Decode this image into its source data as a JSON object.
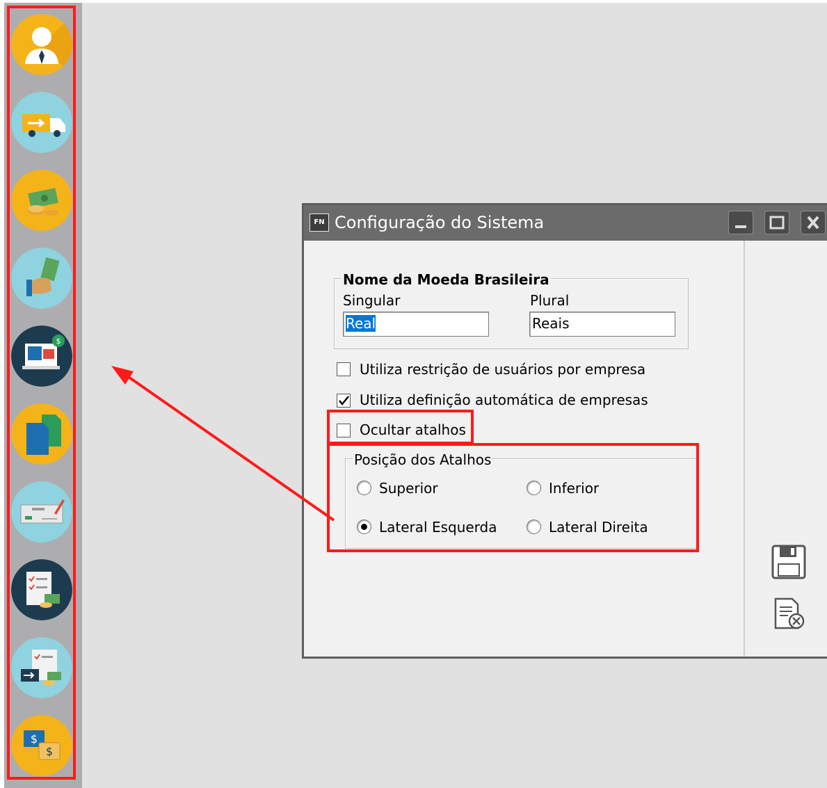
{
  "sidebar": {
    "shortcuts": [
      {
        "name": "user-icon",
        "bg": "#f5b31a"
      },
      {
        "name": "delivery-truck-icon",
        "bg": "#8ed3df"
      },
      {
        "name": "money-coins-icon",
        "bg": "#f5b31a"
      },
      {
        "name": "hand-money-icon",
        "bg": "#8ed3df"
      },
      {
        "name": "computer-payment-icon",
        "bg": "#1d3b4f"
      },
      {
        "name": "documents-icon",
        "bg": "#f5b31a"
      },
      {
        "name": "bank-check-icon",
        "bg": "#8ed3df"
      },
      {
        "name": "checklist-money-icon",
        "bg": "#1d3b4f"
      },
      {
        "name": "checklist-transfer-icon",
        "bg": "#8ed3df"
      },
      {
        "name": "currency-exchange-icon",
        "bg": "#f5b31a"
      }
    ]
  },
  "window": {
    "app_icon": "FN",
    "title": "Configuração do Sistema"
  },
  "currency": {
    "group_title": "Nome da Moeda Brasileira",
    "singular_label": "Singular",
    "singular_value": "Real",
    "plural_label": "Plural",
    "plural_value": "Reais"
  },
  "options": {
    "restrict_users": {
      "label": "Utiliza restrição de usuários por empresa",
      "checked": false
    },
    "auto_companies": {
      "label": "Utiliza definição automática de empresas",
      "checked": true
    },
    "hide_shortcuts": {
      "label": "Ocultar atalhos",
      "checked": false
    }
  },
  "position": {
    "group_title": "Posição dos Atalhos",
    "superior": "Superior",
    "inferior": "Inferior",
    "lateral_esquerda": "Lateral Esquerda",
    "lateral_direita": "Lateral Direita",
    "selected": "lateral_esquerda"
  },
  "colors": {
    "annotation": "#ff1a1a",
    "selection": "#0078d7"
  }
}
